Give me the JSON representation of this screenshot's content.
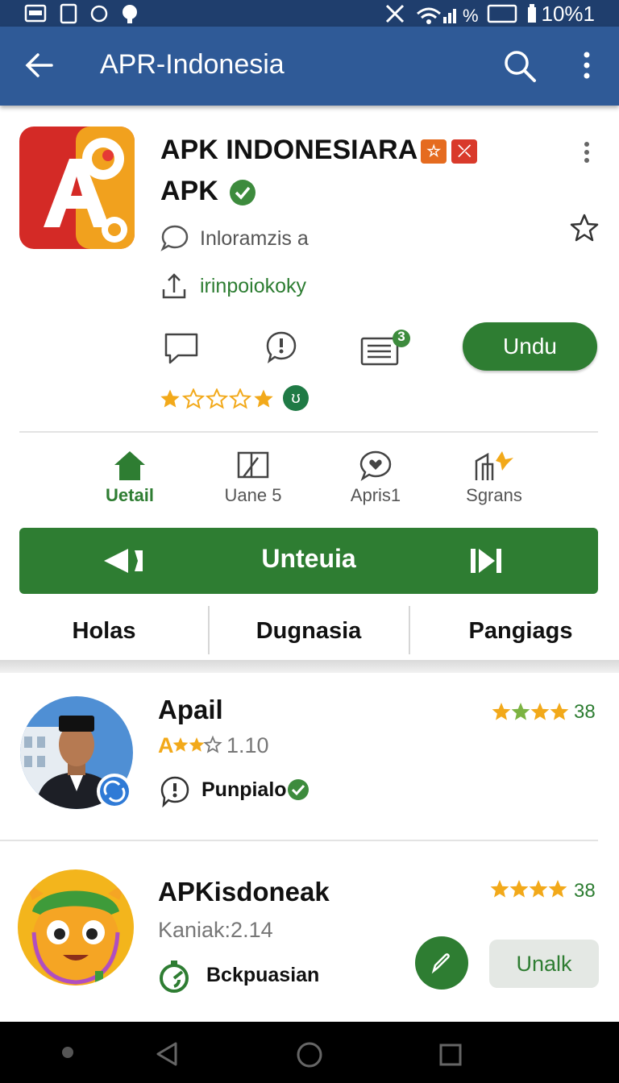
{
  "status_bar": {
    "right_text": "10%1",
    "battery_label": "%"
  },
  "app_bar": {
    "title": "APR-Indonesia",
    "colors": {
      "bar": "#2f5a97",
      "status": "#1f3e6d"
    }
  },
  "app_header": {
    "title_line1": "APK INDONESIARA",
    "title_line2": "APK",
    "badge1": "☆",
    "badge2": "⤫",
    "developer": "Inloramzis a",
    "downloads": "irinpoiokoky",
    "install_button": "Undu",
    "rating": 2,
    "rating_max": 5,
    "list_badge": "3",
    "rating_badge": "ʊ"
  },
  "tabs": [
    {
      "label": "Uetail",
      "icon": "home-icon",
      "active": true
    },
    {
      "label": "Uane 5",
      "icon": "frame-icon",
      "active": false
    },
    {
      "label": "Apris1",
      "icon": "heart-chat-icon",
      "active": false
    },
    {
      "label": "Sgrans",
      "icon": "building-icon",
      "active": false
    }
  ],
  "banner": {
    "label": "Unteuia"
  },
  "segments": [
    "Holas",
    "Dugnasia",
    "Pangiags"
  ],
  "list": [
    {
      "title": "Apail",
      "rating_prefix": "A",
      "rating_value": "1.10",
      "link": "Punpialo",
      "score": "38",
      "avatar": "person-avatar"
    },
    {
      "title": "APKisdoneak",
      "subtitle": "Kaniak:2.14",
      "link": "Bckpuasian",
      "score": "38",
      "button": "Unalk",
      "avatar": "cartoon-avatar"
    }
  ],
  "accent": "#2e7d32",
  "star_color": "#f2a91a"
}
